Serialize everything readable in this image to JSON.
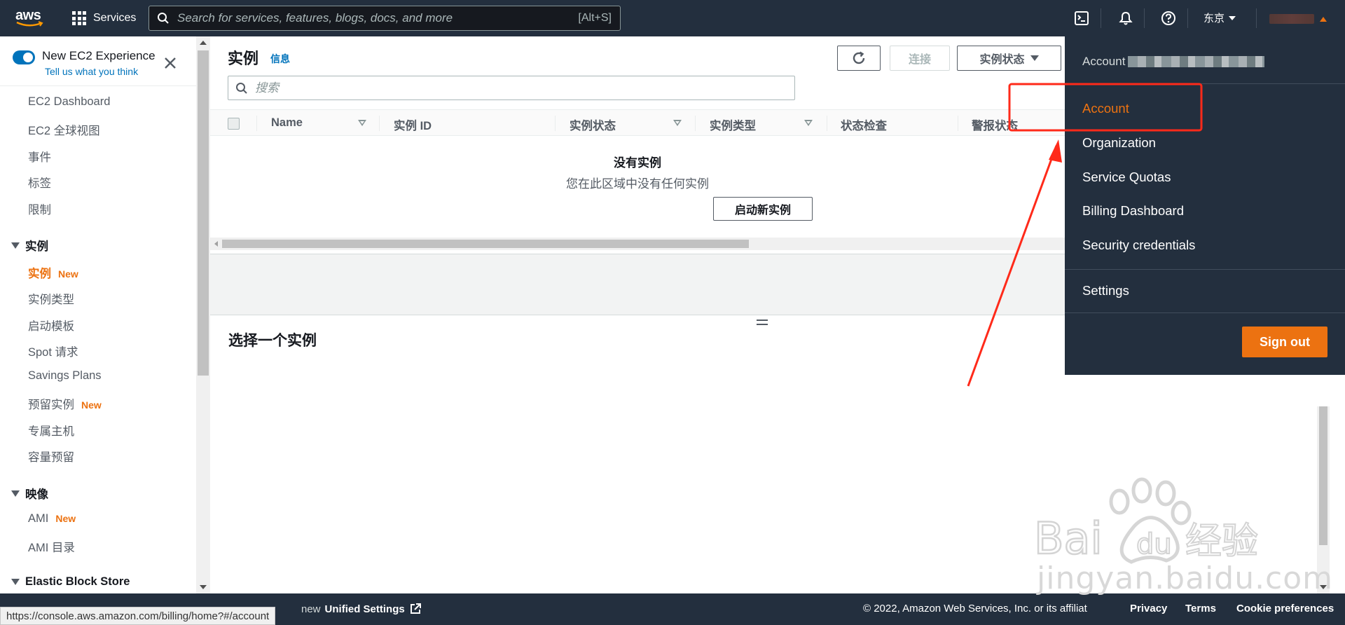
{
  "topnav": {
    "logo_text": "aws",
    "services_label": "Services",
    "search_placeholder": "Search for services, features, blogs, docs, and more",
    "search_shortcut": "[Alt+S]",
    "region_label": "东京",
    "icons": [
      "cloudshell-icon",
      "bell-icon",
      "help-icon"
    ]
  },
  "sidebar": {
    "new_experience_title": "New EC2 Experience",
    "new_experience_link": "Tell us what you think",
    "links_top": [
      {
        "label": "EC2 Dashboard"
      },
      {
        "label": "EC2 全球视图"
      },
      {
        "label": "事件"
      },
      {
        "label": "标签"
      },
      {
        "label": "限制"
      }
    ],
    "section_instances": {
      "title": "实例",
      "items": [
        {
          "label": "实例",
          "badge": "New"
        },
        {
          "label": "实例类型"
        },
        {
          "label": "启动模板"
        },
        {
          "label": "Spot 请求"
        },
        {
          "label": "Savings Plans"
        },
        {
          "label": "预留实例",
          "badge": "New"
        },
        {
          "label": "专属主机"
        },
        {
          "label": "容量预留"
        }
      ]
    },
    "section_images": {
      "title": "映像",
      "items": [
        {
          "label": "AMI",
          "badge": "New"
        },
        {
          "label": "AMI 目录"
        }
      ]
    },
    "section_ebs": {
      "title": "Elastic Block Store"
    }
  },
  "main": {
    "title": "实例",
    "info_link": "信息",
    "connect_button": "连接",
    "instance_state_button": "实例状态",
    "search_placeholder": "搜索",
    "columns": [
      "Name",
      "实例 ID",
      "实例状态",
      "实例类型",
      "状态检查",
      "警报状态"
    ],
    "empty_title": "没有实例",
    "empty_subtitle": "您在此区域中没有任何实例",
    "launch_button": "启动新实例",
    "detail_title": "选择一个实例"
  },
  "footer": {
    "unified_prefix": "new",
    "unified_link": "Unified Settings",
    "copyright": "© 2022, Amazon Web Services, Inc. or its affiliat",
    "privacy": "Privacy",
    "terms": "Terms",
    "cookie": "Cookie preferences"
  },
  "status_bar": {
    "url": "https://console.aws.amazon.com/billing/home?#/account"
  },
  "account_menu": {
    "account_label": "Account",
    "items": [
      {
        "label": "Account",
        "active": true
      },
      {
        "label": "Organization"
      },
      {
        "label": "Service Quotas"
      },
      {
        "label": "Billing Dashboard"
      },
      {
        "label": "Security credentials"
      },
      {
        "label": "Settings"
      }
    ],
    "sign_out": "Sign out"
  },
  "watermark": {
    "text": "jingyan.baidu.com"
  },
  "colors": {
    "nav_bg": "#232f3e",
    "accent_orange": "#ec7211",
    "link_blue": "#0073bb",
    "annotation_red": "#ff2a1a"
  }
}
